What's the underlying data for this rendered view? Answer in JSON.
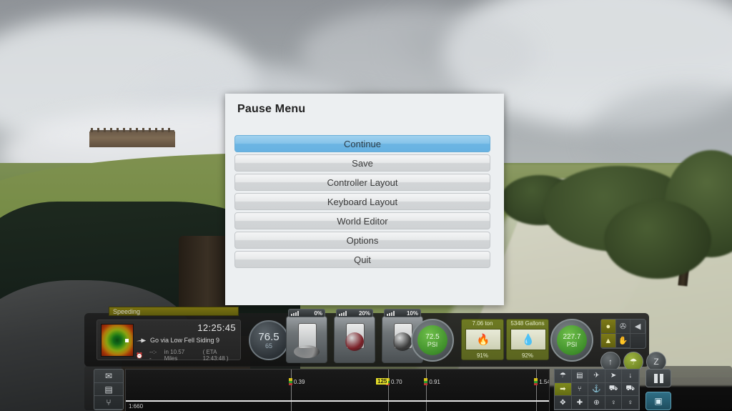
{
  "menu": {
    "title": "Pause Menu",
    "items": [
      {
        "label": "Continue",
        "selected": true
      },
      {
        "label": "Save",
        "selected": false
      },
      {
        "label": "Controller Layout",
        "selected": false
      },
      {
        "label": "Keyboard Layout",
        "selected": false
      },
      {
        "label": "World Editor",
        "selected": false
      },
      {
        "label": "Options",
        "selected": false
      },
      {
        "label": "Quit",
        "selected": false
      }
    ],
    "accent_color": "#86c4ea",
    "panel_color": "#eceff1"
  },
  "hud": {
    "warning": {
      "label": "Speeding",
      "color": "#7a7211"
    },
    "task": {
      "clock": "12:25:45",
      "objective": "Go via Low Fell Siding 9",
      "time_remaining": "--:--",
      "distance": "in 10.57 Miles",
      "eta": "( ETA 12:43:48 )",
      "pointer_icon": "hand-pointer-icon",
      "clock_icon": "clock-icon"
    },
    "speedometer": {
      "current": "76.5",
      "limit": "65"
    },
    "levers": [
      {
        "name": "regulator",
        "percent": "0%",
        "icon": "signal-bars-icon",
        "knob_color": "#8e8e8e"
      },
      {
        "name": "reverser",
        "percent": "20%",
        "icon": "reverser-icon",
        "knob_color": "#7a1f26"
      },
      {
        "name": "brake",
        "percent": "10%",
        "icon": "brake-icon",
        "knob_color": "#3a3a3a"
      }
    ],
    "gauges": [
      {
        "name": "brake-pressure",
        "value": "72.5",
        "unit": "PSI"
      },
      {
        "name": "boiler-pressure",
        "value": "227.7",
        "unit": "PSI"
      }
    ],
    "resources": [
      {
        "name": "coal",
        "amount": "7.06 ton",
        "percent": "91%",
        "icon": "fire-icon",
        "glyph": "🔥"
      },
      {
        "name": "water",
        "amount": "5348 Gallons",
        "percent": "92%",
        "icon": "water-drop-icon",
        "glyph": "💧"
      }
    ],
    "icon_pad": [
      {
        "name": "headlight-icon",
        "glyph": "●",
        "active": true
      },
      {
        "name": "wipers-icon",
        "glyph": "✇",
        "active": false
      },
      {
        "name": "horn-icon",
        "glyph": "◀",
        "active": false
      },
      {
        "name": "bell-icon",
        "glyph": "▲",
        "active": true
      },
      {
        "name": "sander-icon",
        "glyph": "✋",
        "active": false
      }
    ],
    "round_buttons": [
      {
        "name": "whistle-button",
        "glyph": "↑",
        "active": false
      },
      {
        "name": "steam-button",
        "glyph": "☂",
        "active": true
      },
      {
        "name": "lamp-button",
        "glyph": "Z",
        "active": false
      }
    ],
    "side_buttons": [
      {
        "name": "objectives-button",
        "glyph": "✉"
      },
      {
        "name": "map-button",
        "glyph": "▤"
      },
      {
        "name": "junction-button",
        "glyph": "⑂"
      }
    ],
    "track_map": {
      "scale": "1:660",
      "speed_tag": "125",
      "markers": [
        {
          "label": "0.39",
          "position_pct": 39
        },
        {
          "label": "0.70",
          "position_pct": 62
        },
        {
          "label": "0.91",
          "position_pct": 71
        },
        {
          "label": "1.54",
          "position_pct": 97
        }
      ]
    },
    "button_grid": [
      {
        "name": "cab-view-button",
        "glyph": "☂",
        "active": false
      },
      {
        "name": "passenger-view-button",
        "glyph": "▤",
        "active": false
      },
      {
        "name": "free-camera-button",
        "glyph": "✈",
        "active": false
      },
      {
        "name": "track-camera-button",
        "glyph": "➤",
        "active": false
      },
      {
        "name": "coupling-button",
        "glyph": "↓",
        "active": false
      },
      {
        "name": "headout-view-button",
        "glyph": "➡",
        "active": true
      },
      {
        "name": "signal-view-button",
        "glyph": "⑂",
        "active": false
      },
      {
        "name": "boxcar-view-button",
        "glyph": "⚓",
        "active": false
      },
      {
        "name": "wagon-view-button",
        "glyph": "⛟",
        "active": false
      },
      {
        "name": "load-view-button",
        "glyph": "⛟",
        "active": false
      },
      {
        "name": "move-button",
        "glyph": "✥",
        "active": false
      },
      {
        "name": "switch-button",
        "glyph": "✚",
        "active": false
      },
      {
        "name": "world-button",
        "glyph": "⊕",
        "active": false
      },
      {
        "name": "signal-a-button",
        "glyph": "♀",
        "active": false
      },
      {
        "name": "signal-b-button",
        "glyph": "♀",
        "active": false
      }
    ],
    "pause_button": {
      "name": "pause-button",
      "label": ""
    },
    "camera_button": {
      "name": "screenshot-button",
      "glyph": "▣"
    }
  }
}
